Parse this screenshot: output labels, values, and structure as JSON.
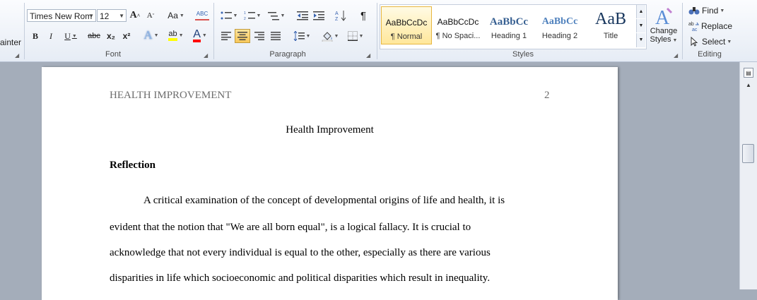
{
  "clipboard": {
    "painter_label": "ainter"
  },
  "font": {
    "group_label": "Font",
    "family_value": "Times New Rom",
    "size_value": "12",
    "grow_label": "A",
    "shrink_label": "A",
    "case_label": "Aa",
    "clear_label": "ABC",
    "bold_label": "B",
    "italic_label": "I",
    "underline_label": "U",
    "strike_label": "abc",
    "sub_label": "x₂",
    "super_label": "x²",
    "effects_label": "A",
    "highlight_label": "ab",
    "color_label": "A",
    "highlight_color": "#ffff00",
    "font_color": "#ff0000"
  },
  "paragraph": {
    "group_label": "Paragraph",
    "marks_label": "¶"
  },
  "styles": {
    "group_label": "Styles",
    "items": [
      {
        "sample": "AaBbCcDc",
        "name": "¶ Normal"
      },
      {
        "sample": "AaBbCcDc",
        "name": "¶ No Spaci..."
      },
      {
        "sample": "AaBbCc",
        "name": "Heading 1"
      },
      {
        "sample": "AaBbCc",
        "name": "Heading 2"
      },
      {
        "sample": "AaB",
        "name": "Title"
      }
    ],
    "change_label_1": "Change",
    "change_label_2": "Styles",
    "heading_color": "#365f91"
  },
  "editing": {
    "group_label": "Editing",
    "find_label": "Find",
    "replace_label": "Replace",
    "select_label": "Select"
  },
  "document": {
    "header_left": "HEALTH IMPROVEMENT",
    "header_page_number": "2",
    "title": "Health Improvement",
    "heading": "Reflection",
    "lines": [
      "A critical examination of the concept of developmental origins of life and health, it is",
      "evident that the notion that \"We are all born equal\", is a logical fallacy. It is crucial to",
      "acknowledge that not every individual is equal to the other, especially as there are various",
      "disparities in life which socioeconomic and political disparities which result in inequality."
    ]
  }
}
